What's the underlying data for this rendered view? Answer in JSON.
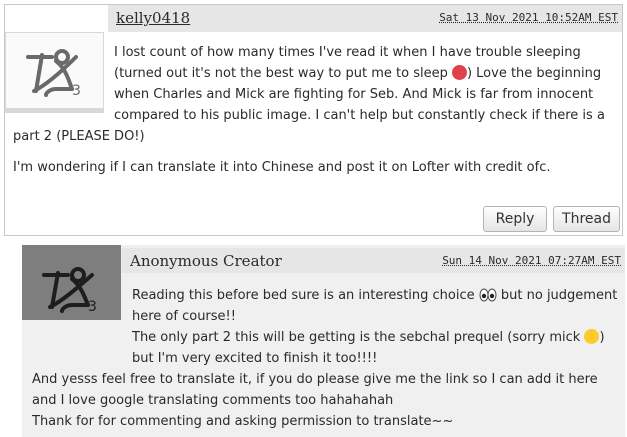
{
  "comment1": {
    "username": "kelly0418",
    "date": "Sat 13 Nov 2021 10:52AM EST",
    "body_line1": "I lost count of how many times I've read it when I have trouble sleeping (turned out it's not the best way to put me to sleep ",
    "body_line1b": ") Love the beginning when Charles and Mick are fighting for Seb. And Mick is far from innocent compared to his public image. I can't help but constantly check if there is a part 2 (PLEASE DO!)",
    "body_para2": "I'm wondering if I can translate it into Chinese and post it on Lofter with credit ofc.",
    "reply_label": "Reply",
    "thread_label": "Thread",
    "avatar_icon": "default-avatar-icon",
    "emoji1": "angry-face-emoji"
  },
  "comment2": {
    "username": "Anonymous Creator",
    "date": "Sun 14 Nov 2021 07:27AM EST",
    "body_a": "Reading this before bed sure is an interesting choice ",
    "body_b": " but no judgement here of course!!",
    "body_c": "The only part 2 this will be getting is the sebchal prequel (sorry mick ",
    "body_d": ") but I'm very excited to finish it too!!!!",
    "body_e": "And yesss feel free to translate it, if you do please give me the link so I can add it here and I love google translating comments too hahahahah",
    "body_f": "Thank for for commenting and asking permission to translate~~",
    "avatar_icon": "default-avatar-icon",
    "emoji_eyes": "eyes-emoji",
    "emoji_sweat": "sweat-smile-emoji"
  }
}
